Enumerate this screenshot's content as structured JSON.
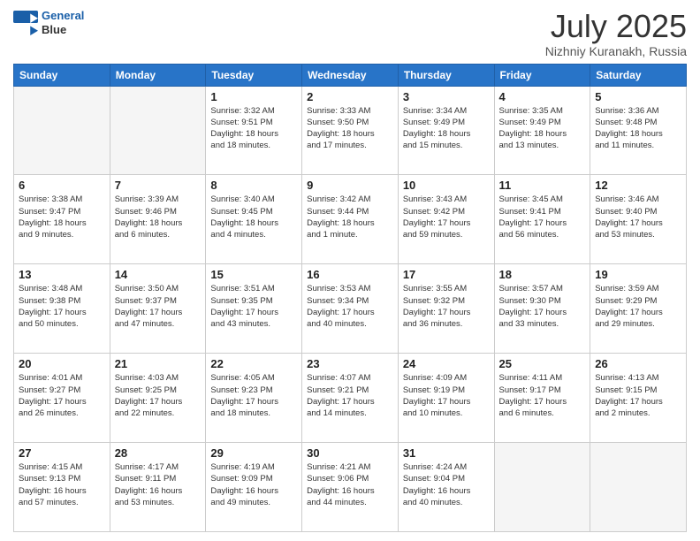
{
  "logo": {
    "line1": "General",
    "line2": "Blue"
  },
  "title": "July 2025",
  "subtitle": "Nizhniy Kuranakh, Russia",
  "days_of_week": [
    "Sunday",
    "Monday",
    "Tuesday",
    "Wednesday",
    "Thursday",
    "Friday",
    "Saturday"
  ],
  "weeks": [
    [
      {
        "day": "",
        "info": ""
      },
      {
        "day": "",
        "info": ""
      },
      {
        "day": "1",
        "info": "Sunrise: 3:32 AM\nSunset: 9:51 PM\nDaylight: 18 hours\nand 18 minutes."
      },
      {
        "day": "2",
        "info": "Sunrise: 3:33 AM\nSunset: 9:50 PM\nDaylight: 18 hours\nand 17 minutes."
      },
      {
        "day": "3",
        "info": "Sunrise: 3:34 AM\nSunset: 9:49 PM\nDaylight: 18 hours\nand 15 minutes."
      },
      {
        "day": "4",
        "info": "Sunrise: 3:35 AM\nSunset: 9:49 PM\nDaylight: 18 hours\nand 13 minutes."
      },
      {
        "day": "5",
        "info": "Sunrise: 3:36 AM\nSunset: 9:48 PM\nDaylight: 18 hours\nand 11 minutes."
      }
    ],
    [
      {
        "day": "6",
        "info": "Sunrise: 3:38 AM\nSunset: 9:47 PM\nDaylight: 18 hours\nand 9 minutes."
      },
      {
        "day": "7",
        "info": "Sunrise: 3:39 AM\nSunset: 9:46 PM\nDaylight: 18 hours\nand 6 minutes."
      },
      {
        "day": "8",
        "info": "Sunrise: 3:40 AM\nSunset: 9:45 PM\nDaylight: 18 hours\nand 4 minutes."
      },
      {
        "day": "9",
        "info": "Sunrise: 3:42 AM\nSunset: 9:44 PM\nDaylight: 18 hours\nand 1 minute."
      },
      {
        "day": "10",
        "info": "Sunrise: 3:43 AM\nSunset: 9:42 PM\nDaylight: 17 hours\nand 59 minutes."
      },
      {
        "day": "11",
        "info": "Sunrise: 3:45 AM\nSunset: 9:41 PM\nDaylight: 17 hours\nand 56 minutes."
      },
      {
        "day": "12",
        "info": "Sunrise: 3:46 AM\nSunset: 9:40 PM\nDaylight: 17 hours\nand 53 minutes."
      }
    ],
    [
      {
        "day": "13",
        "info": "Sunrise: 3:48 AM\nSunset: 9:38 PM\nDaylight: 17 hours\nand 50 minutes."
      },
      {
        "day": "14",
        "info": "Sunrise: 3:50 AM\nSunset: 9:37 PM\nDaylight: 17 hours\nand 47 minutes."
      },
      {
        "day": "15",
        "info": "Sunrise: 3:51 AM\nSunset: 9:35 PM\nDaylight: 17 hours\nand 43 minutes."
      },
      {
        "day": "16",
        "info": "Sunrise: 3:53 AM\nSunset: 9:34 PM\nDaylight: 17 hours\nand 40 minutes."
      },
      {
        "day": "17",
        "info": "Sunrise: 3:55 AM\nSunset: 9:32 PM\nDaylight: 17 hours\nand 36 minutes."
      },
      {
        "day": "18",
        "info": "Sunrise: 3:57 AM\nSunset: 9:30 PM\nDaylight: 17 hours\nand 33 minutes."
      },
      {
        "day": "19",
        "info": "Sunrise: 3:59 AM\nSunset: 9:29 PM\nDaylight: 17 hours\nand 29 minutes."
      }
    ],
    [
      {
        "day": "20",
        "info": "Sunrise: 4:01 AM\nSunset: 9:27 PM\nDaylight: 17 hours\nand 26 minutes."
      },
      {
        "day": "21",
        "info": "Sunrise: 4:03 AM\nSunset: 9:25 PM\nDaylight: 17 hours\nand 22 minutes."
      },
      {
        "day": "22",
        "info": "Sunrise: 4:05 AM\nSunset: 9:23 PM\nDaylight: 17 hours\nand 18 minutes."
      },
      {
        "day": "23",
        "info": "Sunrise: 4:07 AM\nSunset: 9:21 PM\nDaylight: 17 hours\nand 14 minutes."
      },
      {
        "day": "24",
        "info": "Sunrise: 4:09 AM\nSunset: 9:19 PM\nDaylight: 17 hours\nand 10 minutes."
      },
      {
        "day": "25",
        "info": "Sunrise: 4:11 AM\nSunset: 9:17 PM\nDaylight: 17 hours\nand 6 minutes."
      },
      {
        "day": "26",
        "info": "Sunrise: 4:13 AM\nSunset: 9:15 PM\nDaylight: 17 hours\nand 2 minutes."
      }
    ],
    [
      {
        "day": "27",
        "info": "Sunrise: 4:15 AM\nSunset: 9:13 PM\nDaylight: 16 hours\nand 57 minutes."
      },
      {
        "day": "28",
        "info": "Sunrise: 4:17 AM\nSunset: 9:11 PM\nDaylight: 16 hours\nand 53 minutes."
      },
      {
        "day": "29",
        "info": "Sunrise: 4:19 AM\nSunset: 9:09 PM\nDaylight: 16 hours\nand 49 minutes."
      },
      {
        "day": "30",
        "info": "Sunrise: 4:21 AM\nSunset: 9:06 PM\nDaylight: 16 hours\nand 44 minutes."
      },
      {
        "day": "31",
        "info": "Sunrise: 4:24 AM\nSunset: 9:04 PM\nDaylight: 16 hours\nand 40 minutes."
      },
      {
        "day": "",
        "info": ""
      },
      {
        "day": "",
        "info": ""
      }
    ]
  ]
}
